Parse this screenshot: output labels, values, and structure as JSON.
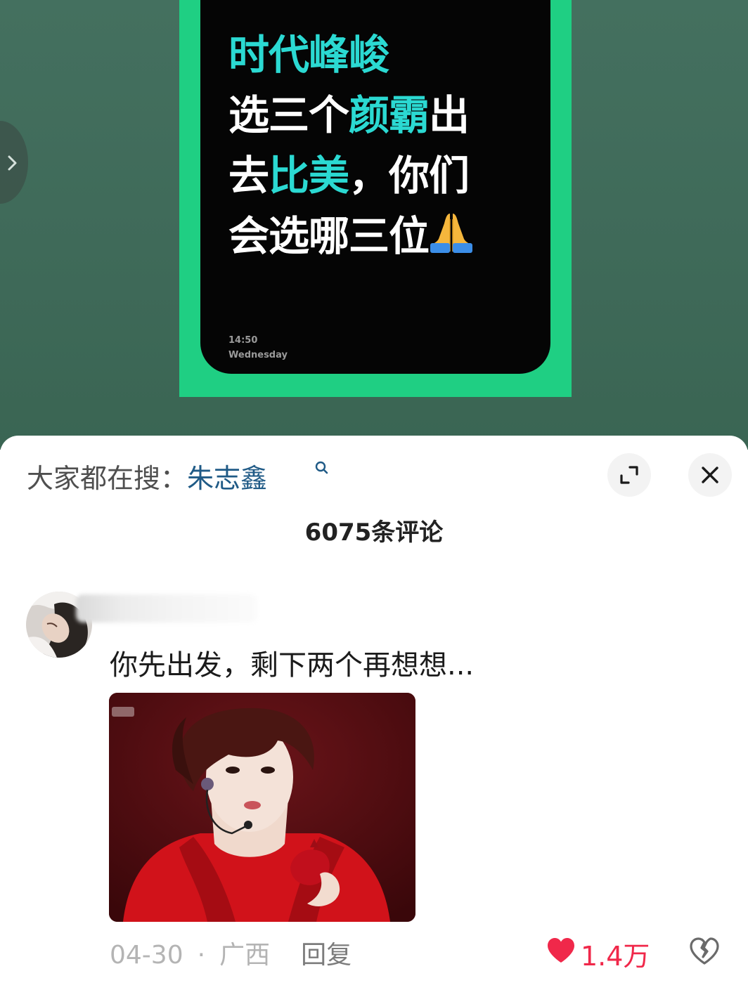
{
  "poster": {
    "line1": "时代峰峻",
    "line2_a": "选三个",
    "line2_b": "颜霸",
    "line2_c": "出",
    "line3_a": "去",
    "line3_b": "比美",
    "line3_c": "，你们",
    "line4": "会选哪三位",
    "time": "14:50",
    "day": "Wednesday",
    "highlight_color": "#2bd9d2",
    "frame_color": "#1fcf83",
    "emoji_icon": "folded-hands-icon"
  },
  "sheet": {
    "search_prefix": "大家都在搜：",
    "search_term": "朱志鑫",
    "comment_count": "6075条评论"
  },
  "comment": {
    "text": "你先出发，剩下两个再想想...",
    "date": "04-30",
    "separator": "·",
    "location": "广西",
    "reply_label": "回复",
    "like_count": "1.4万",
    "like_color": "#f0284a"
  }
}
